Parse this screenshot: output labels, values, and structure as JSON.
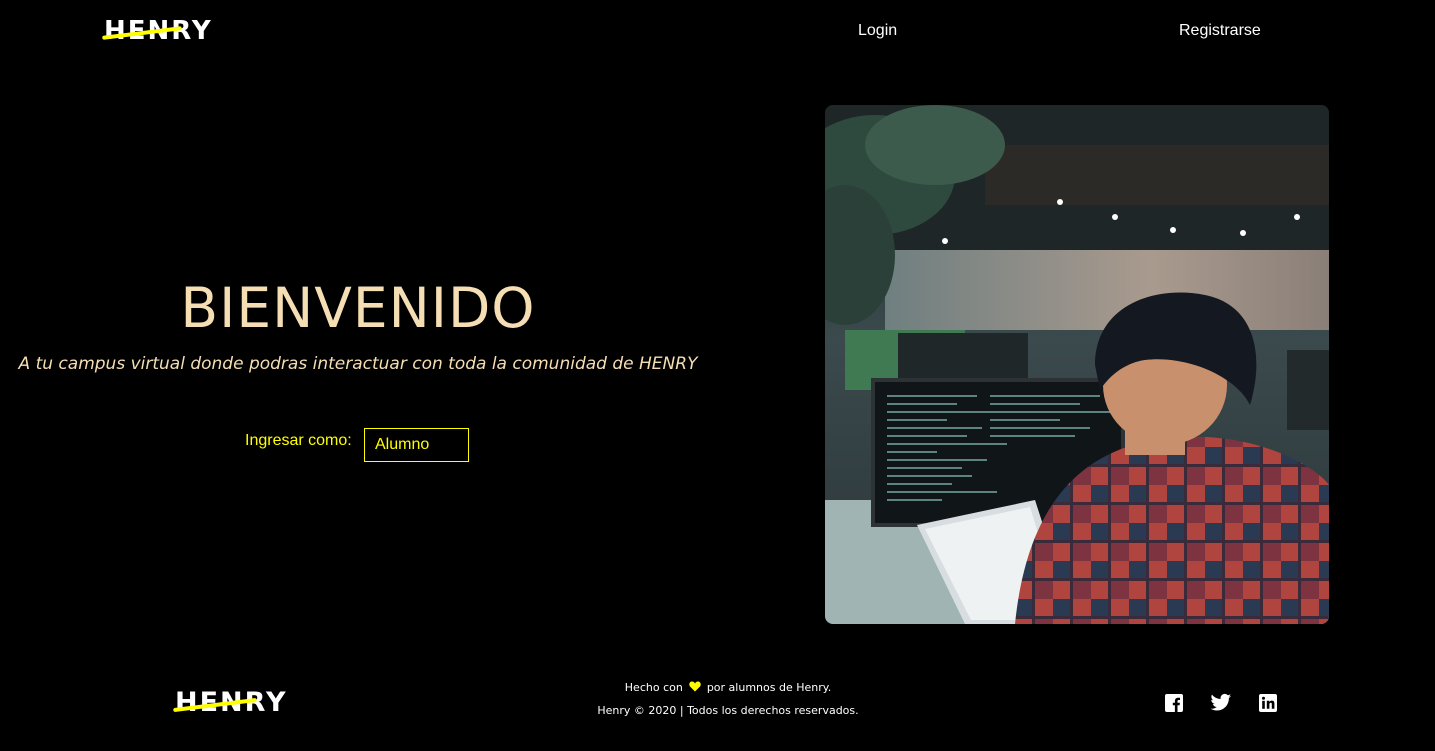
{
  "header": {
    "logo": "HENRY",
    "nav": {
      "login": "Login",
      "register": "Registrarse"
    }
  },
  "hero": {
    "title": "BIENVENIDO",
    "subtitle": "A tu campus virtual donde podras interactuar con toda la comunidad de HENRY",
    "role_label": "Ingresar como:",
    "role_value": "Alumno"
  },
  "footer": {
    "logo": "HENRY",
    "made_with_prefix": "Hecho con",
    "made_with_suffix": "por alumnos de Henry.",
    "copyright": "Henry © 2020 | Todos los derechos reservados.",
    "social": [
      "facebook-icon",
      "twitter-icon",
      "linkedin-icon"
    ]
  },
  "colors": {
    "background": "#000000",
    "accent": "#ffff01",
    "title": "#f5deb3",
    "text": "#ffffff"
  }
}
